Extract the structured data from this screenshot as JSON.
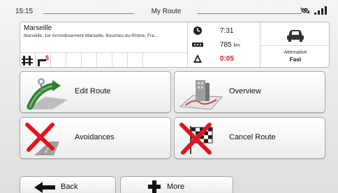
{
  "status_bar": {
    "time": "15:15",
    "title": "My Route",
    "gps_icon": "gps-satellite-icon",
    "signal_icon": "signal-strength-icon"
  },
  "route_info": {
    "destination_city": "Marseille",
    "destination_address": "Marseille, 1er Arrondissement Marseille, Bouches-du-Rhône, Fra...",
    "restriction_icons": [
      "toll-road-icon",
      "toll-fee-icon"
    ],
    "arrival_time": "7:31",
    "distance_value": "785",
    "distance_unit": "km",
    "duration": "0:05",
    "vehicle_icon": "car-icon",
    "route_method_label": "Alternative",
    "route_method_value": "Fast",
    "accent_red": "#e0141e"
  },
  "buttons": {
    "edit_route": "Edit Route",
    "overview": "Overview",
    "avoidances": "Avoidances",
    "cancel_route": "Cancel Route",
    "back": "Back",
    "more": "More"
  }
}
